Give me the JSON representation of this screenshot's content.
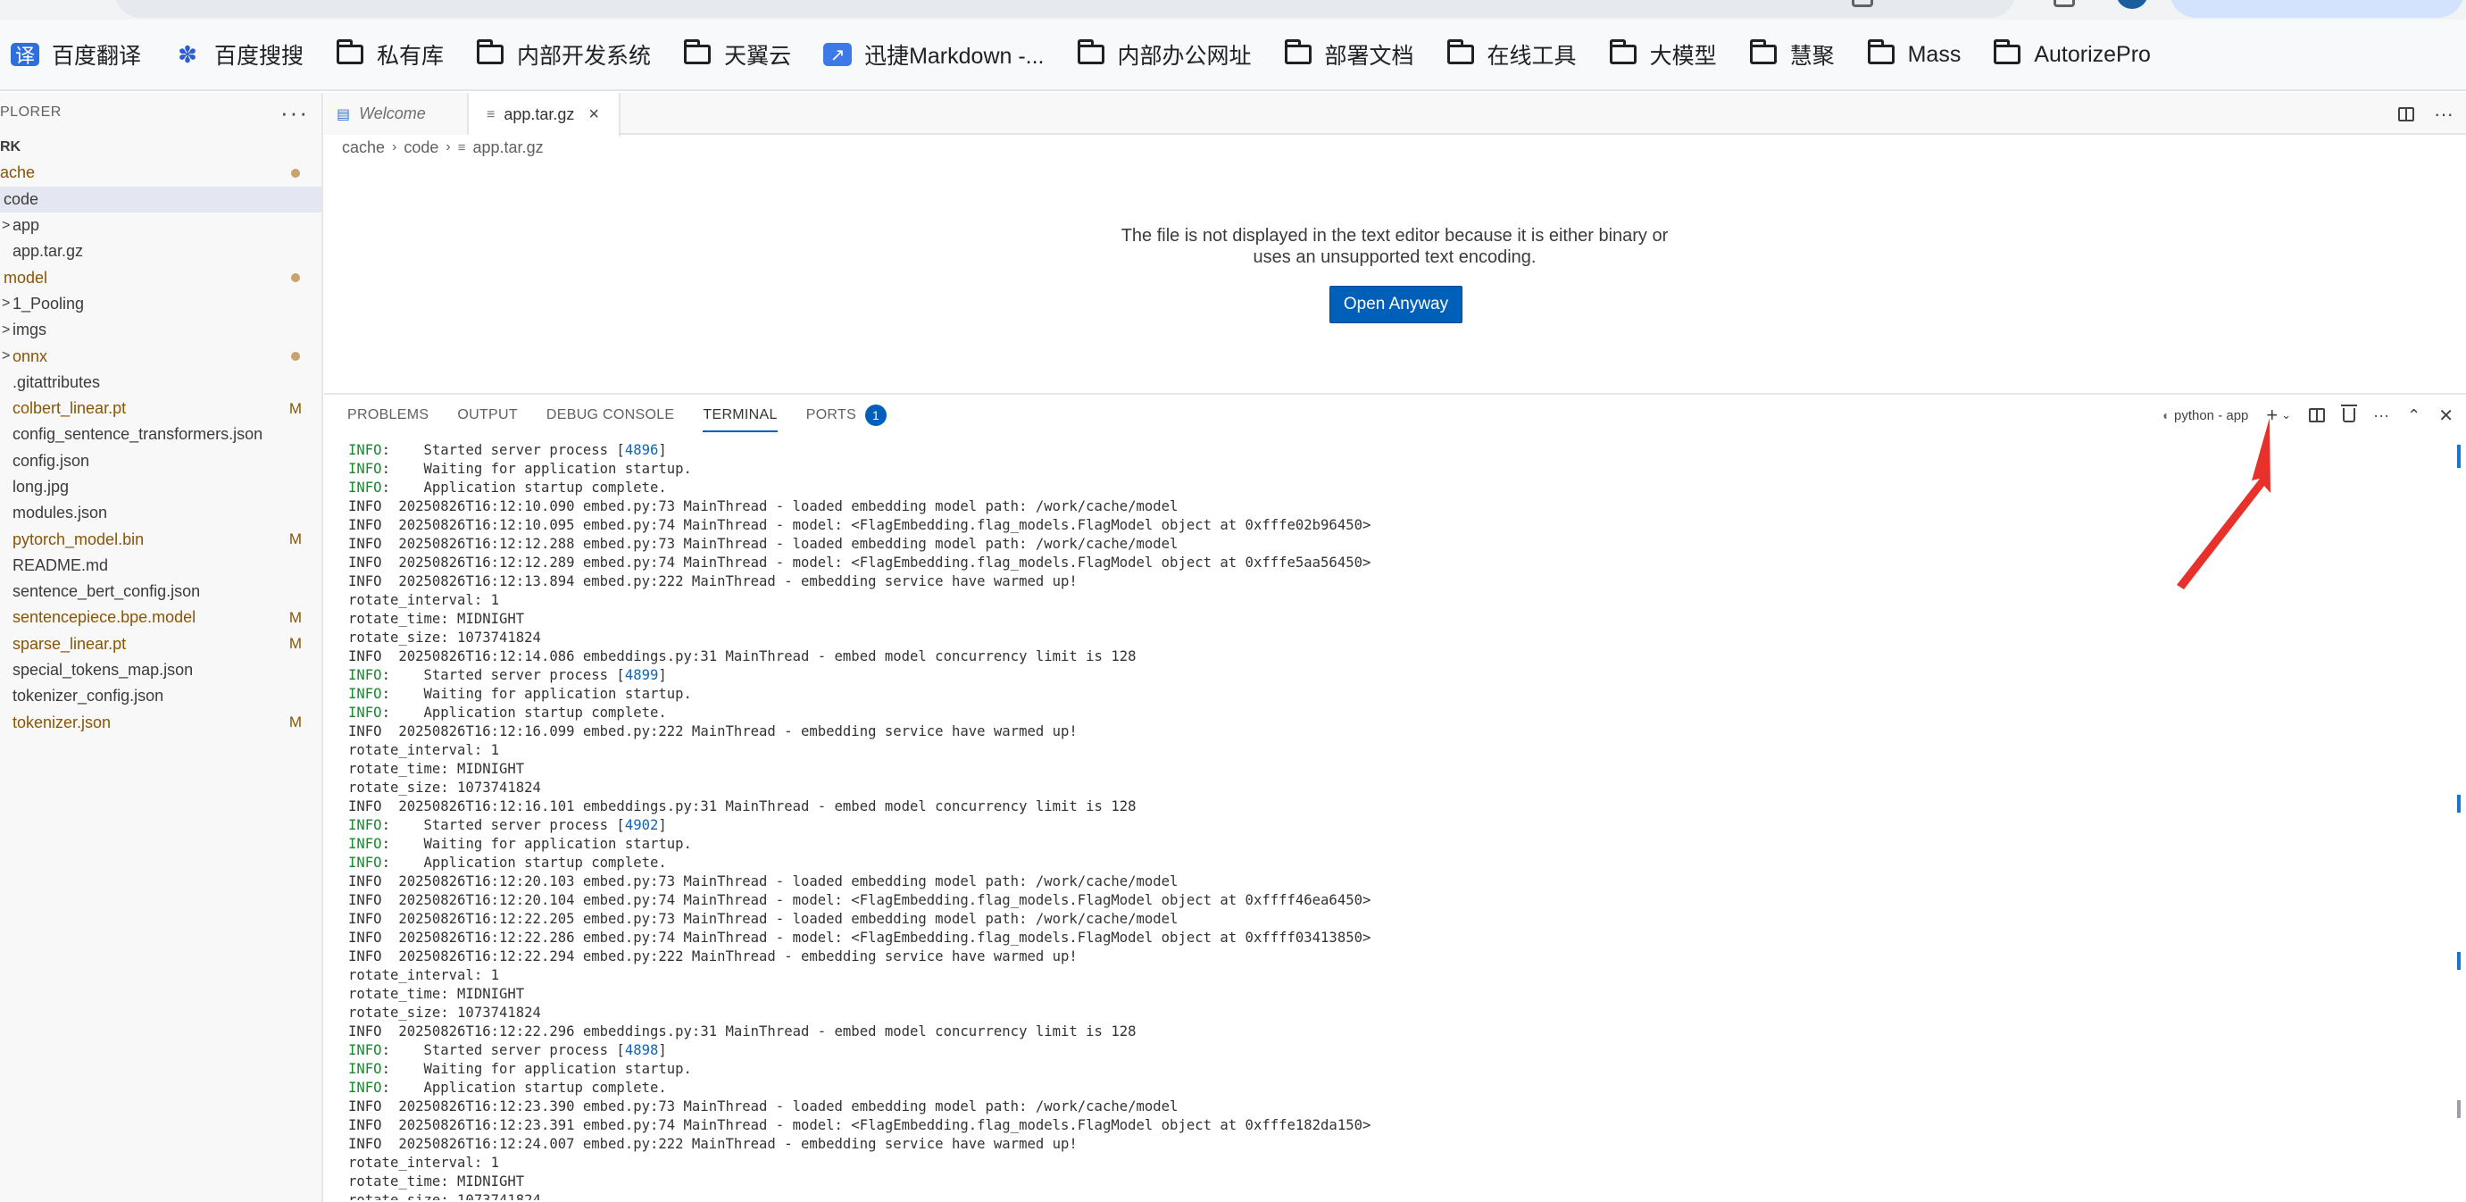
{
  "bookmarks": [
    {
      "label": "百度翻译",
      "icon": "baidu-translate-icon"
    },
    {
      "label": "百度搜搜",
      "icon": "baidu-paw-icon"
    },
    {
      "label": "私有库",
      "icon": "folder-icon"
    },
    {
      "label": "内部开发系统",
      "icon": "folder-icon"
    },
    {
      "label": "天翼云",
      "icon": "folder-icon"
    },
    {
      "label": "迅捷Markdown -...",
      "icon": "markdown-app-icon"
    },
    {
      "label": "内部办公网址",
      "icon": "folder-icon"
    },
    {
      "label": "部署文档",
      "icon": "folder-icon"
    },
    {
      "label": "在线工具",
      "icon": "folder-icon"
    },
    {
      "label": "大模型",
      "icon": "folder-icon"
    },
    {
      "label": "慧聚",
      "icon": "folder-icon"
    },
    {
      "label": "Mass",
      "icon": "folder-icon"
    },
    {
      "label": "AutorizePro",
      "icon": "folder-icon"
    }
  ],
  "sidebar": {
    "title": "PLORER",
    "more": "···",
    "items": [
      {
        "label": "RK",
        "kind": "root",
        "indent": 0,
        "chevron": "",
        "status": "",
        "modified": false
      },
      {
        "label": "ache",
        "kind": "folder",
        "indent": 0,
        "chevron": "",
        "status": "dot",
        "modified": true
      },
      {
        "label": "code",
        "kind": "folder",
        "indent": 1,
        "chevron": "",
        "status": "",
        "modified": false,
        "selected": true
      },
      {
        "label": "app",
        "kind": "folder",
        "indent": 2,
        "chevron": ">",
        "status": "",
        "modified": false
      },
      {
        "label": "app.tar.gz",
        "kind": "file",
        "indent": 2,
        "chevron": "",
        "status": "",
        "modified": false
      },
      {
        "label": "model",
        "kind": "folder",
        "indent": 1,
        "chevron": "",
        "status": "dot",
        "modified": true
      },
      {
        "label": "1_Pooling",
        "kind": "folder",
        "indent": 2,
        "chevron": ">",
        "status": "",
        "modified": false
      },
      {
        "label": "imgs",
        "kind": "folder",
        "indent": 2,
        "chevron": ">",
        "status": "",
        "modified": false
      },
      {
        "label": "onnx",
        "kind": "folder",
        "indent": 2,
        "chevron": ">",
        "status": "dot",
        "modified": true
      },
      {
        "label": ".gitattributes",
        "kind": "file",
        "indent": 2,
        "chevron": "",
        "status": "",
        "modified": false
      },
      {
        "label": "colbert_linear.pt",
        "kind": "file",
        "indent": 2,
        "chevron": "",
        "status": "M",
        "modified": true
      },
      {
        "label": "config_sentence_transformers.json",
        "kind": "file",
        "indent": 2,
        "chevron": "",
        "status": "",
        "modified": false
      },
      {
        "label": "config.json",
        "kind": "file",
        "indent": 2,
        "chevron": "",
        "status": "",
        "modified": false
      },
      {
        "label": "long.jpg",
        "kind": "file",
        "indent": 2,
        "chevron": "",
        "status": "",
        "modified": false
      },
      {
        "label": "modules.json",
        "kind": "file",
        "indent": 2,
        "chevron": "",
        "status": "",
        "modified": false
      },
      {
        "label": "pytorch_model.bin",
        "kind": "file",
        "indent": 2,
        "chevron": "",
        "status": "M",
        "modified": true
      },
      {
        "label": "README.md",
        "kind": "file",
        "indent": 2,
        "chevron": "",
        "status": "",
        "modified": false
      },
      {
        "label": "sentence_bert_config.json",
        "kind": "file",
        "indent": 2,
        "chevron": "",
        "status": "",
        "modified": false
      },
      {
        "label": "sentencepiece.bpe.model",
        "kind": "file",
        "indent": 2,
        "chevron": "",
        "status": "M",
        "modified": true
      },
      {
        "label": "sparse_linear.pt",
        "kind": "file",
        "indent": 2,
        "chevron": "",
        "status": "M",
        "modified": true
      },
      {
        "label": "special_tokens_map.json",
        "kind": "file",
        "indent": 2,
        "chevron": "",
        "status": "",
        "modified": false
      },
      {
        "label": "tokenizer_config.json",
        "kind": "file",
        "indent": 2,
        "chevron": "",
        "status": "",
        "modified": false
      },
      {
        "label": "tokenizer.json",
        "kind": "file",
        "indent": 2,
        "chevron": "",
        "status": "M",
        "modified": true
      }
    ]
  },
  "editor": {
    "tabs": [
      {
        "label": "Welcome",
        "active": false
      },
      {
        "label": "app.tar.gz",
        "active": true,
        "close": "×"
      }
    ],
    "breadcrumb": {
      "part1": "cache",
      "part2": "code",
      "part3": "app.tar.gz"
    },
    "message_line1": "The file is not displayed in the text editor because it is either binary or",
    "message_line2": "uses an unsupported text encoding.",
    "open_button": "Open Anyway"
  },
  "panel": {
    "tabs": [
      {
        "label": "PROBLEMS",
        "active": false
      },
      {
        "label": "OUTPUT",
        "active": false
      },
      {
        "label": "DEBUG CONSOLE",
        "active": false
      },
      {
        "label": "TERMINAL",
        "active": true
      },
      {
        "label": "PORTS",
        "active": false,
        "badge": "1"
      }
    ],
    "terminal_name": "python - app",
    "terminal_lines": [
      {
        "lvl": "INFO",
        "uv": true,
        "text": ":    Started server process [",
        "num": "4896",
        "tail": "]"
      },
      {
        "lvl": "INFO",
        "uv": true,
        "text": ":    Waiting for application startup."
      },
      {
        "lvl": "INFO",
        "uv": true,
        "text": ":    Application startup complete."
      },
      {
        "lvl": "INFO",
        "uv": false,
        "text": "  20250826T16:12:10.090 embed.py:73 MainThread - loaded embedding model path: /work/cache/model"
      },
      {
        "lvl": "INFO",
        "uv": false,
        "text": "  20250826T16:12:10.095 embed.py:74 MainThread - model: <FlagEmbedding.flag_models.FlagModel object at 0xfffe02b96450>"
      },
      {
        "lvl": "INFO",
        "uv": false,
        "text": "  20250826T16:12:12.288 embed.py:73 MainThread - loaded embedding model path: /work/cache/model"
      },
      {
        "lvl": "INFO",
        "uv": false,
        "text": "  20250826T16:12:12.289 embed.py:74 MainThread - model: <FlagEmbedding.flag_models.FlagModel object at 0xfffe5aa56450>"
      },
      {
        "lvl": "INFO",
        "uv": false,
        "text": "  20250826T16:12:13.894 embed.py:222 MainThread - embedding service have warmed up!"
      },
      {
        "lvl": "",
        "uv": false,
        "text": "rotate_interval: 1"
      },
      {
        "lvl": "",
        "uv": false,
        "text": "rotate_time: MIDNIGHT"
      },
      {
        "lvl": "",
        "uv": false,
        "text": "rotate_size: 1073741824"
      },
      {
        "lvl": "INFO",
        "uv": false,
        "text": "  20250826T16:12:14.086 embeddings.py:31 MainThread - embed model concurrency limit is 128"
      },
      {
        "lvl": "INFO",
        "uv": true,
        "text": ":    Started server process [",
        "num": "4899",
        "tail": "]"
      },
      {
        "lvl": "INFO",
        "uv": true,
        "text": ":    Waiting for application startup."
      },
      {
        "lvl": "INFO",
        "uv": true,
        "text": ":    Application startup complete."
      },
      {
        "lvl": "INFO",
        "uv": false,
        "text": "  20250826T16:12:16.099 embed.py:222 MainThread - embedding service have warmed up!"
      },
      {
        "lvl": "",
        "uv": false,
        "text": "rotate_interval: 1"
      },
      {
        "lvl": "",
        "uv": false,
        "text": "rotate_time: MIDNIGHT"
      },
      {
        "lvl": "",
        "uv": false,
        "text": "rotate_size: 1073741824"
      },
      {
        "lvl": "INFO",
        "uv": false,
        "text": "  20250826T16:12:16.101 embeddings.py:31 MainThread - embed model concurrency limit is 128"
      },
      {
        "lvl": "INFO",
        "uv": true,
        "text": ":    Started server process [",
        "num": "4902",
        "tail": "]"
      },
      {
        "lvl": "INFO",
        "uv": true,
        "text": ":    Waiting for application startup."
      },
      {
        "lvl": "INFO",
        "uv": true,
        "text": ":    Application startup complete."
      },
      {
        "lvl": "INFO",
        "uv": false,
        "text": "  20250826T16:12:20.103 embed.py:73 MainThread - loaded embedding model path: /work/cache/model"
      },
      {
        "lvl": "INFO",
        "uv": false,
        "text": "  20250826T16:12:20.104 embed.py:74 MainThread - model: <FlagEmbedding.flag_models.FlagModel object at 0xffff46ea6450>"
      },
      {
        "lvl": "INFO",
        "uv": false,
        "text": "  20250826T16:12:22.205 embed.py:73 MainThread - loaded embedding model path: /work/cache/model"
      },
      {
        "lvl": "INFO",
        "uv": false,
        "text": "  20250826T16:12:22.286 embed.py:74 MainThread - model: <FlagEmbedding.flag_models.FlagModel object at 0xffff03413850>"
      },
      {
        "lvl": "INFO",
        "uv": false,
        "text": "  20250826T16:12:22.294 embed.py:222 MainThread - embedding service have warmed up!"
      },
      {
        "lvl": "",
        "uv": false,
        "text": "rotate_interval: 1"
      },
      {
        "lvl": "",
        "uv": false,
        "text": "rotate_time: MIDNIGHT"
      },
      {
        "lvl": "",
        "uv": false,
        "text": "rotate_size: 1073741824"
      },
      {
        "lvl": "INFO",
        "uv": false,
        "text": "  20250826T16:12:22.296 embeddings.py:31 MainThread - embed model concurrency limit is 128"
      },
      {
        "lvl": "INFO",
        "uv": true,
        "text": ":    Started server process [",
        "num": "4898",
        "tail": "]"
      },
      {
        "lvl": "INFO",
        "uv": true,
        "text": ":    Waiting for application startup."
      },
      {
        "lvl": "INFO",
        "uv": true,
        "text": ":    Application startup complete."
      },
      {
        "lvl": "INFO",
        "uv": false,
        "text": "  20250826T16:12:23.390 embed.py:73 MainThread - loaded embedding model path: /work/cache/model"
      },
      {
        "lvl": "INFO",
        "uv": false,
        "text": "  20250826T16:12:23.391 embed.py:74 MainThread - model: <FlagEmbedding.flag_models.FlagModel object at 0xfffe182da150>"
      },
      {
        "lvl": "INFO",
        "uv": false,
        "text": "  20250826T16:12:24.007 embed.py:222 MainThread - embedding service have warmed up!"
      },
      {
        "lvl": "",
        "uv": false,
        "text": "rotate_interval: 1"
      },
      {
        "lvl": "",
        "uv": false,
        "text": "rotate_time: MIDNIGHT"
      },
      {
        "lvl": "",
        "uv": false,
        "text": "rotate_size: 1073741824"
      }
    ]
  },
  "colors": {
    "accent": "#005fb8",
    "modified": "#895503",
    "uvicorn_info": "#148c2a",
    "pid": "#1265b0",
    "annotation_arrow": "#e8312a"
  }
}
